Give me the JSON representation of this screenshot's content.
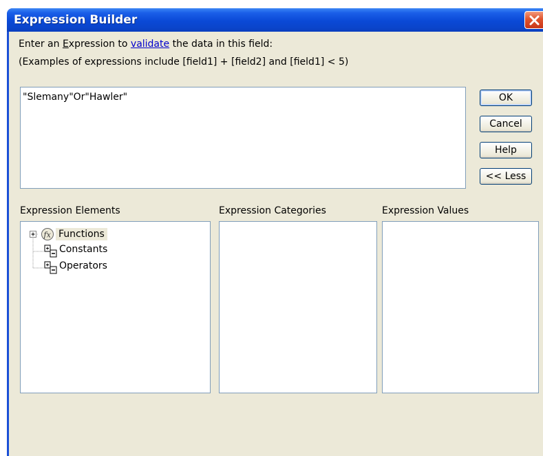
{
  "window": {
    "title": "Expression Builder"
  },
  "prompt": {
    "line1_prefix": "Enter an ",
    "line1_accel": "E",
    "line1_word_rest": "xpression to ",
    "line1_link": "validate",
    "line1_suffix": " the data in this field:",
    "line2": "(Examples of expressions include [field1] + [field2] and [field1] < 5)"
  },
  "expression": {
    "value": "\"Slemany\"Or\"Hawler\""
  },
  "buttons": {
    "ok": "OK",
    "cancel": "Cancel",
    "help": "Help",
    "less": "<< Less"
  },
  "sections": {
    "elements": "Expression Elements",
    "categories": "Expression Categories",
    "values": "Expression Values"
  },
  "tree": {
    "items": [
      {
        "label": "Functions",
        "icon": "function-icon",
        "expander": "plus",
        "selected": true
      },
      {
        "label": "Constants",
        "icon": "folder-icon",
        "selected": false
      },
      {
        "label": "Operators",
        "icon": "folder-icon",
        "selected": false
      }
    ]
  },
  "colors": {
    "titlebar": "#0a49d6",
    "client_bg": "#ece9d8",
    "link": "#0000cc",
    "close": "#e0532c"
  }
}
